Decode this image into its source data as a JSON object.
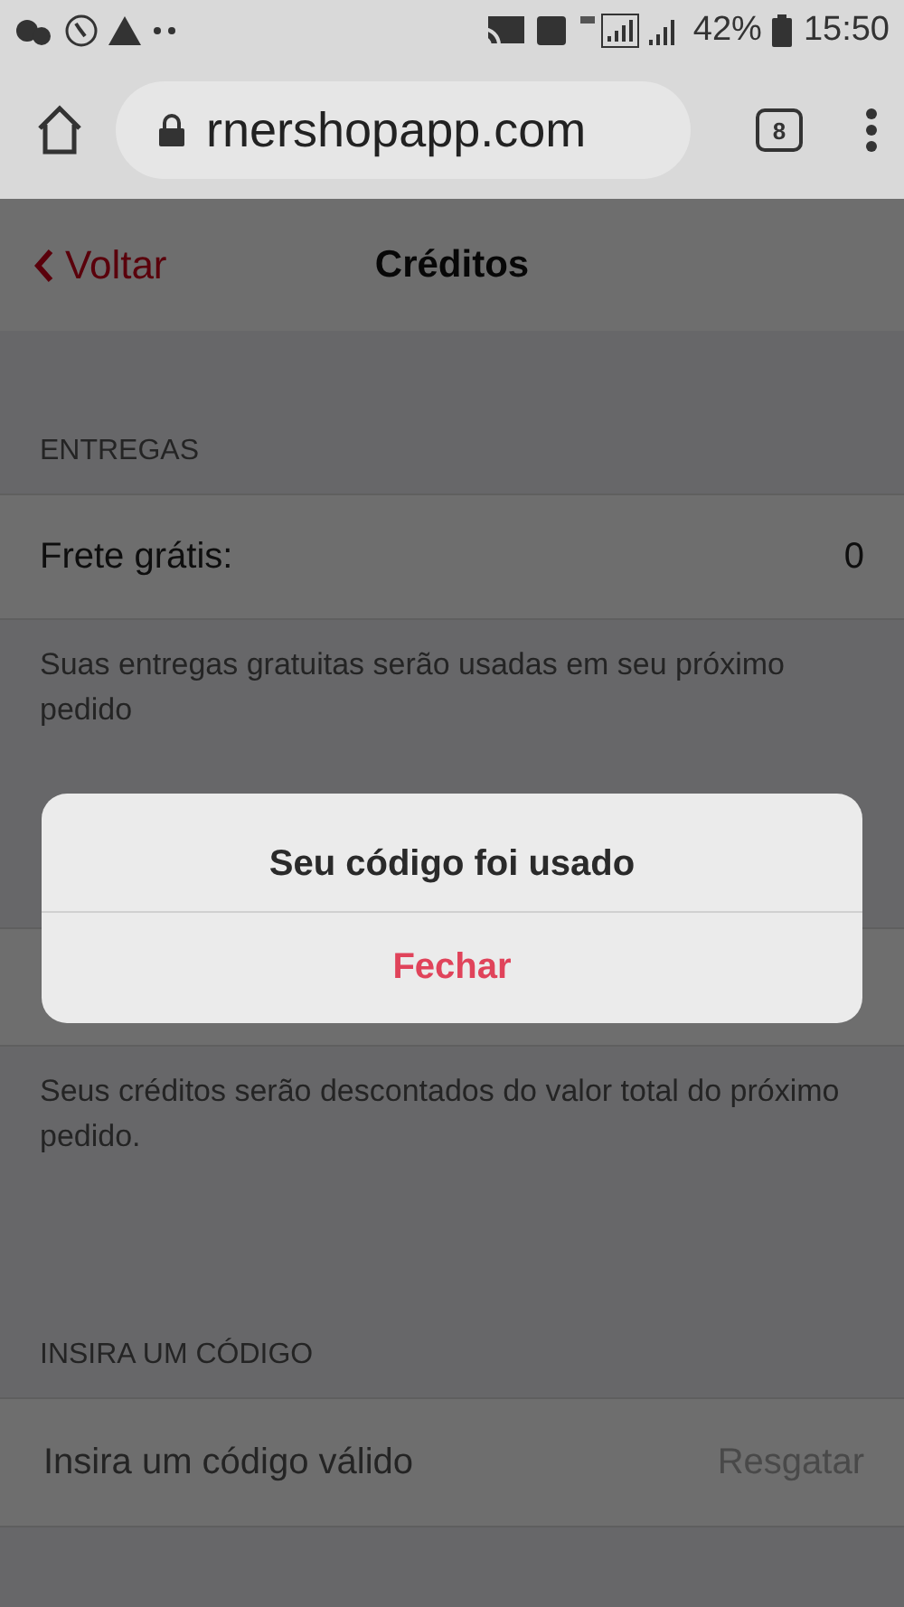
{
  "status_bar": {
    "battery": "42%",
    "time": "15:50"
  },
  "browser": {
    "url": "rnershopapp.com",
    "tab_count": "8"
  },
  "nav": {
    "back": "Voltar",
    "title": "Créditos"
  },
  "deliveries": {
    "header": "ENTREGAS",
    "label": "Frete grátis:",
    "value": "0",
    "note": "Suas entregas gratuitas serão usadas em seu próximo pedido"
  },
  "credits": {
    "note": "Seus créditos serão descontados do valor total do próximo pedido."
  },
  "code": {
    "header": "INSIRA UM CÓDIGO",
    "placeholder": "Insira um código válido",
    "button": {
      "label": "Resgatar",
      "disabled": true
    }
  },
  "dialog": {
    "message": "Seu código foi usado",
    "button": "Fechar"
  }
}
